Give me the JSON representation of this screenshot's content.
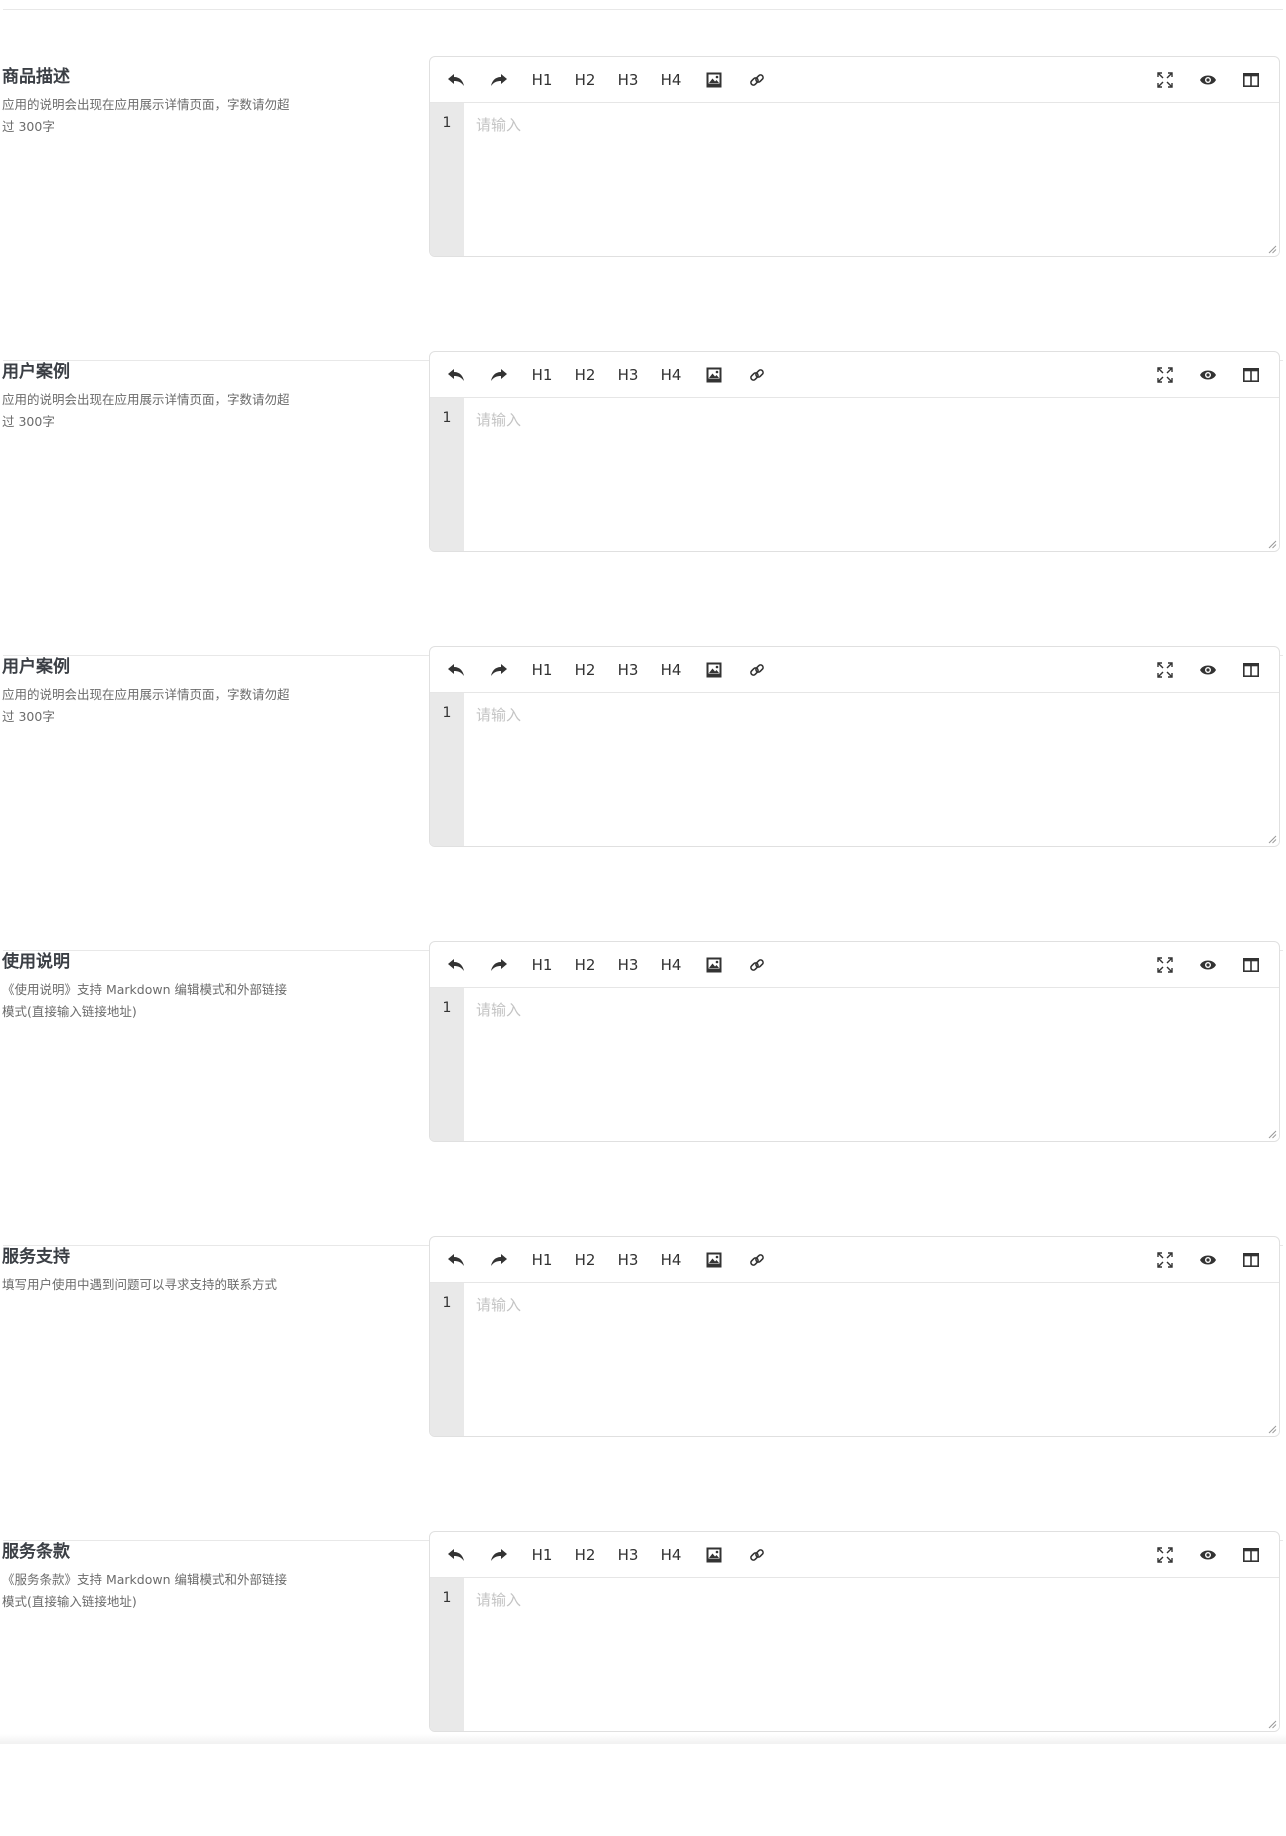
{
  "editor": {
    "placeholder": "请输入",
    "line_number": "1",
    "headings": [
      "H1",
      "H2",
      "H3",
      "H4"
    ],
    "icons": {
      "undo": "undo-icon",
      "redo": "redo-icon",
      "image": "image-icon",
      "link": "link-icon",
      "fullscreen": "fullscreen-icon",
      "preview": "eye-icon",
      "split": "split-view-icon"
    }
  },
  "sections": [
    {
      "title": "商品描述",
      "desc": "应用的说明会出现在应用展示详情页面，字数请勿超过 300字"
    },
    {
      "title": "用户案例",
      "desc": "应用的说明会出现在应用展示详情页面，字数请勿超过 300字"
    },
    {
      "title": "用户案例",
      "desc": "应用的说明会出现在应用展示详情页面，字数请勿超过 300字"
    },
    {
      "title": "使用说明",
      "desc": "《使用说明》支持 Markdown 编辑模式和外部链接模式(直接输入链接地址)"
    },
    {
      "title": "服务支持",
      "desc": "填写用户使用中遇到问题可以寻求支持的联系方式"
    },
    {
      "title": "服务条款",
      "desc": "《服务条款》支持 Markdown 编辑模式和外部链接模式(直接输入链接地址)"
    }
  ]
}
